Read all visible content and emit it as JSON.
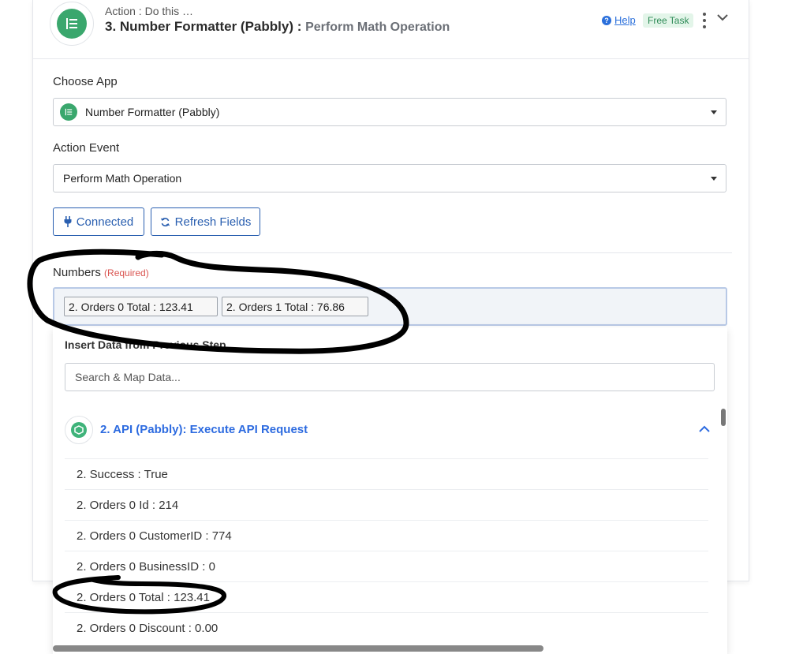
{
  "header": {
    "pre_label": "Action : Do this …",
    "title": "3. Number Formatter (Pabbly) :",
    "subtitle": "Perform Math Operation",
    "help_label": "Help",
    "badge": "Free Task",
    "step_icon": "number-formatter-icon"
  },
  "choose_app": {
    "label": "Choose App",
    "value": "Number Formatter (Pabbly)"
  },
  "action_event": {
    "label": "Action Event",
    "value": "Perform Math Operation"
  },
  "buttons": {
    "connected": "Connected",
    "refresh": "Refresh Fields"
  },
  "numbers": {
    "label": "Numbers",
    "required": "(Required)",
    "chips": [
      "2. Orders 0 Total : 123.41",
      "2. Orders 1 Total : 76.86"
    ]
  },
  "dropdown": {
    "insert_label": "Insert Data from Previous Step",
    "search_placeholder": "Search & Map Data...",
    "group_title": "2. API (Pabbly): Execute API Request",
    "items": [
      "2. Success : True",
      "2. Orders 0 Id : 214",
      "2. Orders 0 CustomerID : 774",
      "2. Orders 0 BusinessID : 0",
      "2. Orders 0 Total : 123.41",
      "2. Orders 0 Discount : 0.00"
    ]
  },
  "colors": {
    "accent": "#2a5fb0",
    "brand_green": "#3aa76d",
    "link_blue": "#2d6be0",
    "required_red": "#d9534f"
  }
}
